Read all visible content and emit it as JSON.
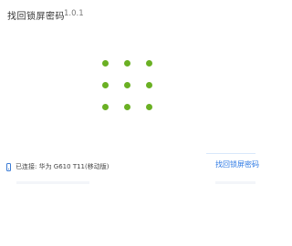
{
  "window": {
    "title": "找回锁屏密码",
    "version": "1.0.1"
  },
  "loading_indicator": {
    "rows": 3,
    "columns": 3,
    "color": "#6ab023"
  },
  "status_bar": {
    "icon": "phone-icon",
    "connection_text": "已连接: 华为 G610 T11(移动版)",
    "action_label": "找回锁屏密码",
    "action_color": "#2b78e4"
  }
}
